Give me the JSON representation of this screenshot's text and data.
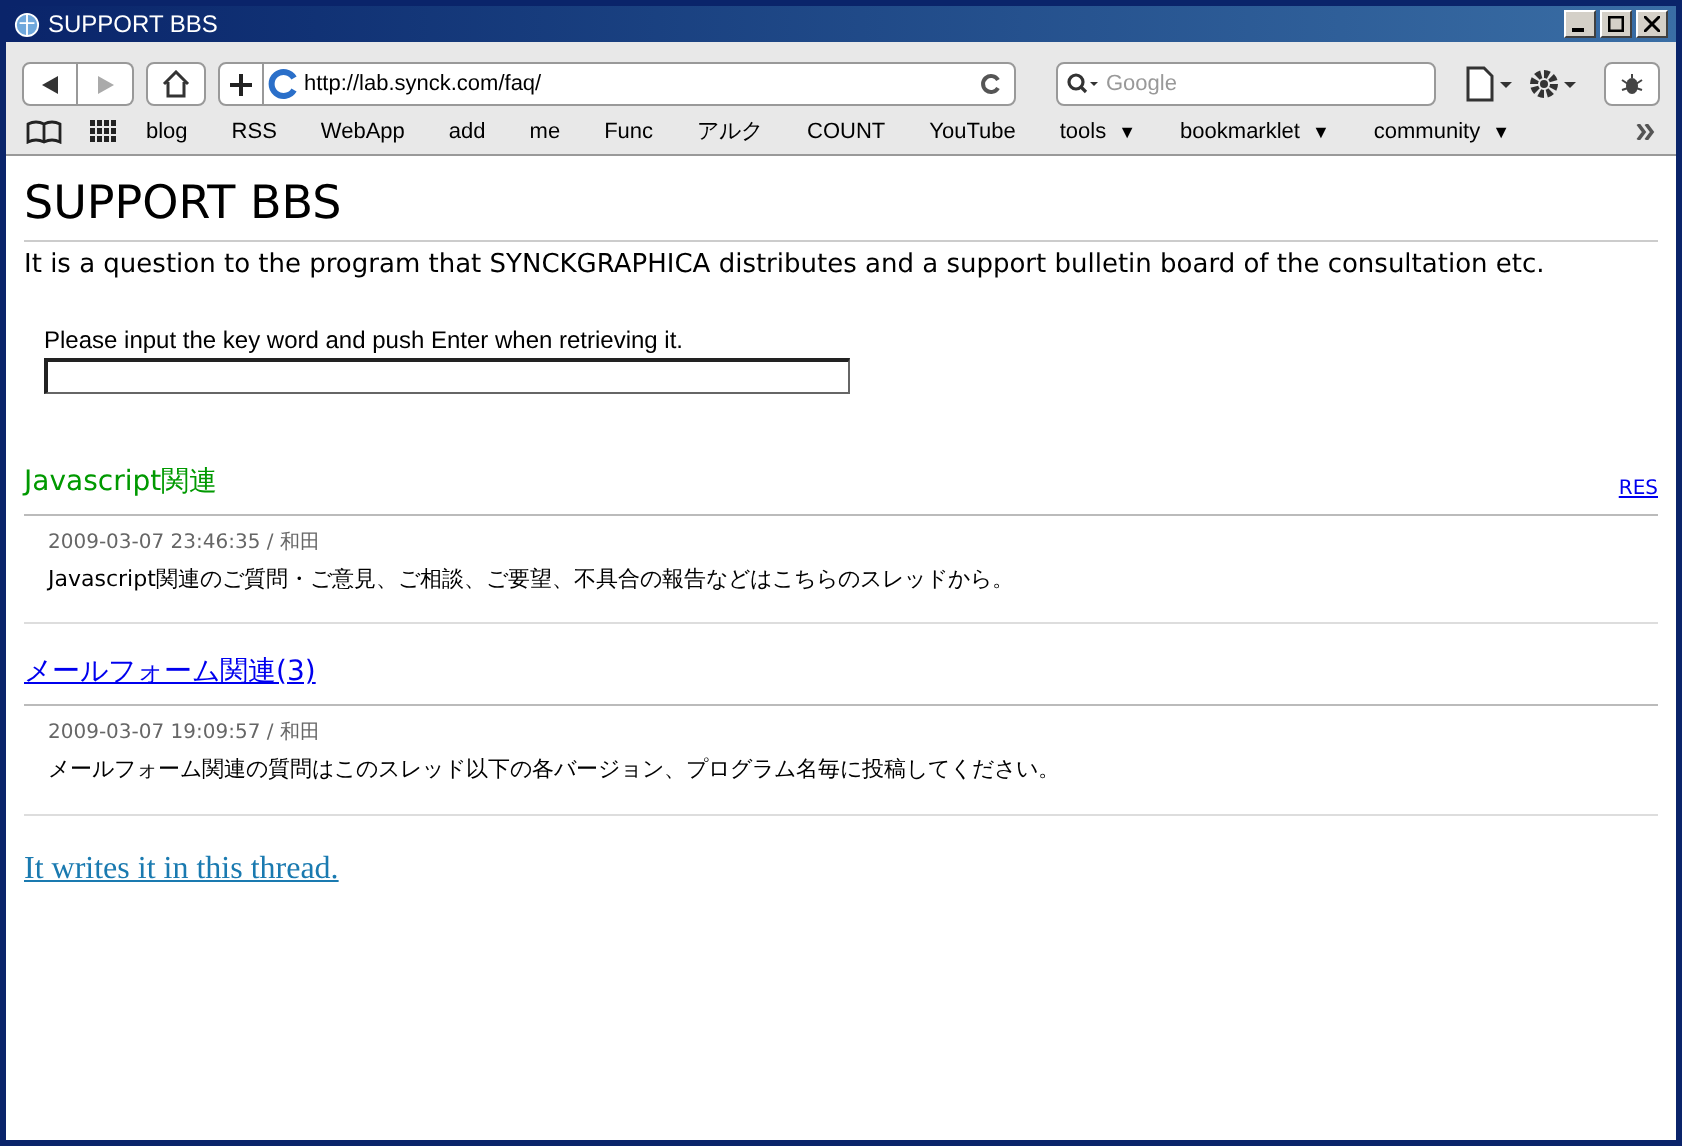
{
  "window": {
    "title": "SUPPORT BBS"
  },
  "toolbar": {
    "url": "http://lab.synck.com/faq/",
    "search_placeholder": "Google"
  },
  "bookmarks": [
    {
      "label": "blog",
      "menu": false
    },
    {
      "label": "RSS",
      "menu": false
    },
    {
      "label": "WebApp",
      "menu": false
    },
    {
      "label": "add",
      "menu": false
    },
    {
      "label": "me",
      "menu": false
    },
    {
      "label": "Func",
      "menu": false
    },
    {
      "label": "アルク",
      "menu": false
    },
    {
      "label": "COUNT",
      "menu": false
    },
    {
      "label": "YouTube",
      "menu": false
    },
    {
      "label": "tools",
      "menu": true,
      "arrow": "▼"
    },
    {
      "label": "bookmarklet",
      "menu": true,
      "arrow": "▼"
    },
    {
      "label": "community",
      "menu": true,
      "arrow": "▼"
    }
  ],
  "page": {
    "title": "SUPPORT BBS",
    "description": "It is a question to the program that SYNCKGRAPHICA distributes and a support bulletin board of the consultation etc.",
    "search_label": "Please input the key word and push Enter when retrieving it.",
    "threads": [
      {
        "title": "Javascript関連",
        "selected": true,
        "res": "RES",
        "date": "2009-03-07 23:46:35 / 和田",
        "body": "Javascript関連のご質問・ご意見、ご相談、ご要望、不具合の報告などはこちらのスレッドから。"
      },
      {
        "title": "メールフォーム関連(3)",
        "selected": false,
        "date": "2009-03-07 19:09:57 / 和田",
        "body": "メールフォーム関連の質問はこのスレッド以下の各バージョン、プログラム名毎に投稿してください。"
      }
    ],
    "write_link": "It writes it in this thread."
  }
}
